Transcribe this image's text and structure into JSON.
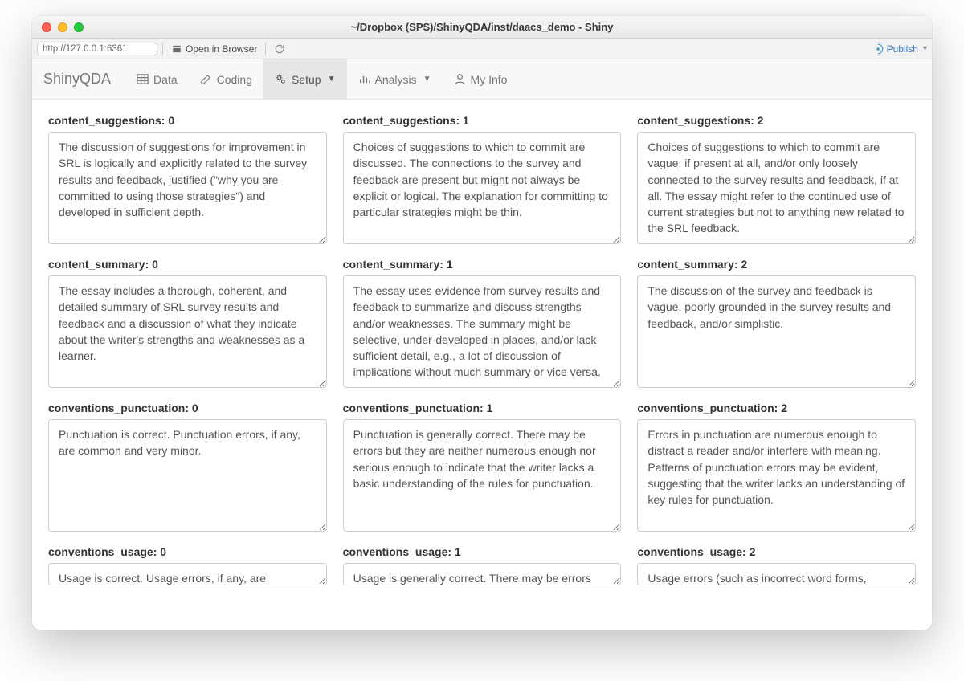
{
  "window": {
    "title": "~/Dropbox (SPS)/ShinyQDA/inst/daacs_demo - Shiny",
    "url": "http://127.0.0.1:6361",
    "open_in_browser": "Open in Browser",
    "publish": "Publish"
  },
  "navbar": {
    "brand": "ShinyQDA",
    "items": [
      {
        "label": "Data"
      },
      {
        "label": "Coding"
      },
      {
        "label": "Setup",
        "dropdown": true,
        "active": true
      },
      {
        "label": "Analysis",
        "dropdown": true
      },
      {
        "label": "My Info"
      }
    ]
  },
  "rubric": {
    "items": [
      {
        "label": "content_suggestions: 0",
        "text": "The discussion of suggestions for improvement in SRL is logically and explicitly related to the survey results and feedback, justified (\"why you are committed to using those strategies\") and developed in sufficient depth."
      },
      {
        "label": "content_suggestions: 1",
        "text": "Choices of suggestions to which to commit are discussed. The connections to the survey and feedback are present but might not always be explicit or logical. The explanation for committing to particular strategies might be thin."
      },
      {
        "label": "content_suggestions: 2",
        "text": "Choices of suggestions to which to commit are vague, if present at all, and/or only loosely connected to the survey results and feedback, if at all. The essay might refer to the continued use of current strategies but not to anything new related to the SRL feedback."
      },
      {
        "label": "content_summary: 0",
        "text": "The essay includes a thorough, coherent, and detailed summary of SRL survey results and feedback and a discussion of what they indicate about the writer's strengths and weaknesses as a learner."
      },
      {
        "label": "content_summary: 1",
        "text": "The essay uses evidence from survey results and feedback to summarize and discuss strengths and/or weaknesses. The summary might be selective, under-developed in places, and/or lack sufficient detail, e.g., a lot of discussion of implications without much summary or vice versa."
      },
      {
        "label": "content_summary: 2",
        "text": "The discussion of the survey and feedback is vague, poorly grounded in the survey results and feedback, and/or simplistic."
      },
      {
        "label": "conventions_punctuation: 0",
        "text": "Punctuation is correct. Punctuation errors, if any, are common and very minor."
      },
      {
        "label": "conventions_punctuation: 1",
        "text": "Punctuation is generally correct. There may be errors but they are neither numerous enough nor serious enough to indicate that the writer lacks a basic understanding of the rules for punctuation."
      },
      {
        "label": "conventions_punctuation: 2",
        "text": "Errors in punctuation are numerous enough to distract a reader and/or interfere with meaning. Patterns of punctuation errors may be evident, suggesting that the writer lacks an understanding of key rules for punctuation."
      },
      {
        "label": "conventions_usage: 0",
        "text": "Usage is correct. Usage errors, if any, are"
      },
      {
        "label": "conventions_usage: 1",
        "text": "Usage is generally correct. There may be errors"
      },
      {
        "label": "conventions_usage: 2",
        "text": "Usage errors (such as incorrect word forms,"
      }
    ]
  }
}
